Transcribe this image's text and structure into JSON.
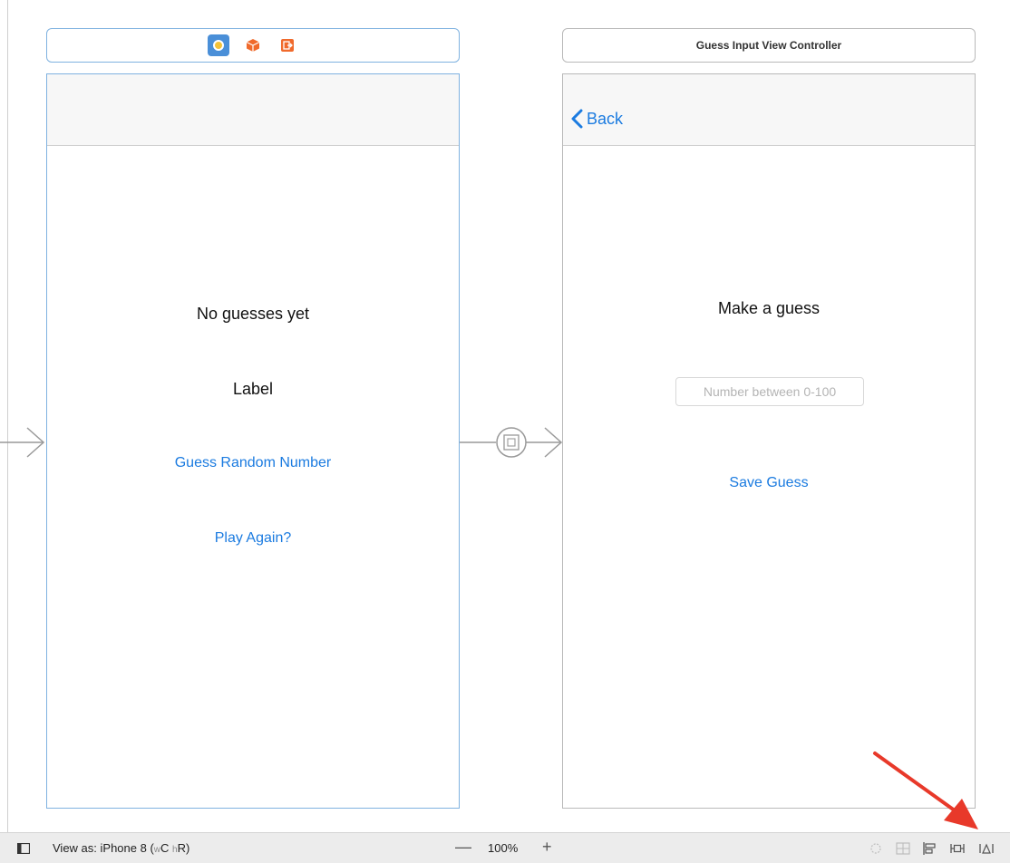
{
  "left_scene": {
    "dock_icons": [
      "view-controller-icon",
      "first-responder-icon",
      "exit-icon"
    ],
    "labels": {
      "no_guesses": "No guesses yet",
      "label": "Label"
    },
    "buttons": {
      "guess_random": "Guess Random Number",
      "play_again": "Play Again?"
    }
  },
  "right_scene": {
    "title": "Guess Input View Controller",
    "back_label": "Back",
    "make_guess": "Make a guess",
    "text_field_placeholder": "Number between 0-100",
    "save_button": "Save Guess"
  },
  "bottom_bar": {
    "view_as_prefix": "View as: iPhone 8 (",
    "size_class_w": "w",
    "size_class_w_val": "C ",
    "size_class_h": "h",
    "size_class_h_val": "R)",
    "zoom_level": "100%",
    "zoom_out": "—",
    "zoom_in": "+"
  },
  "colors": {
    "accent_blue": "#1b7be0",
    "selected_border": "#7fb2e0",
    "annotation_arrow": "#e8392a"
  }
}
